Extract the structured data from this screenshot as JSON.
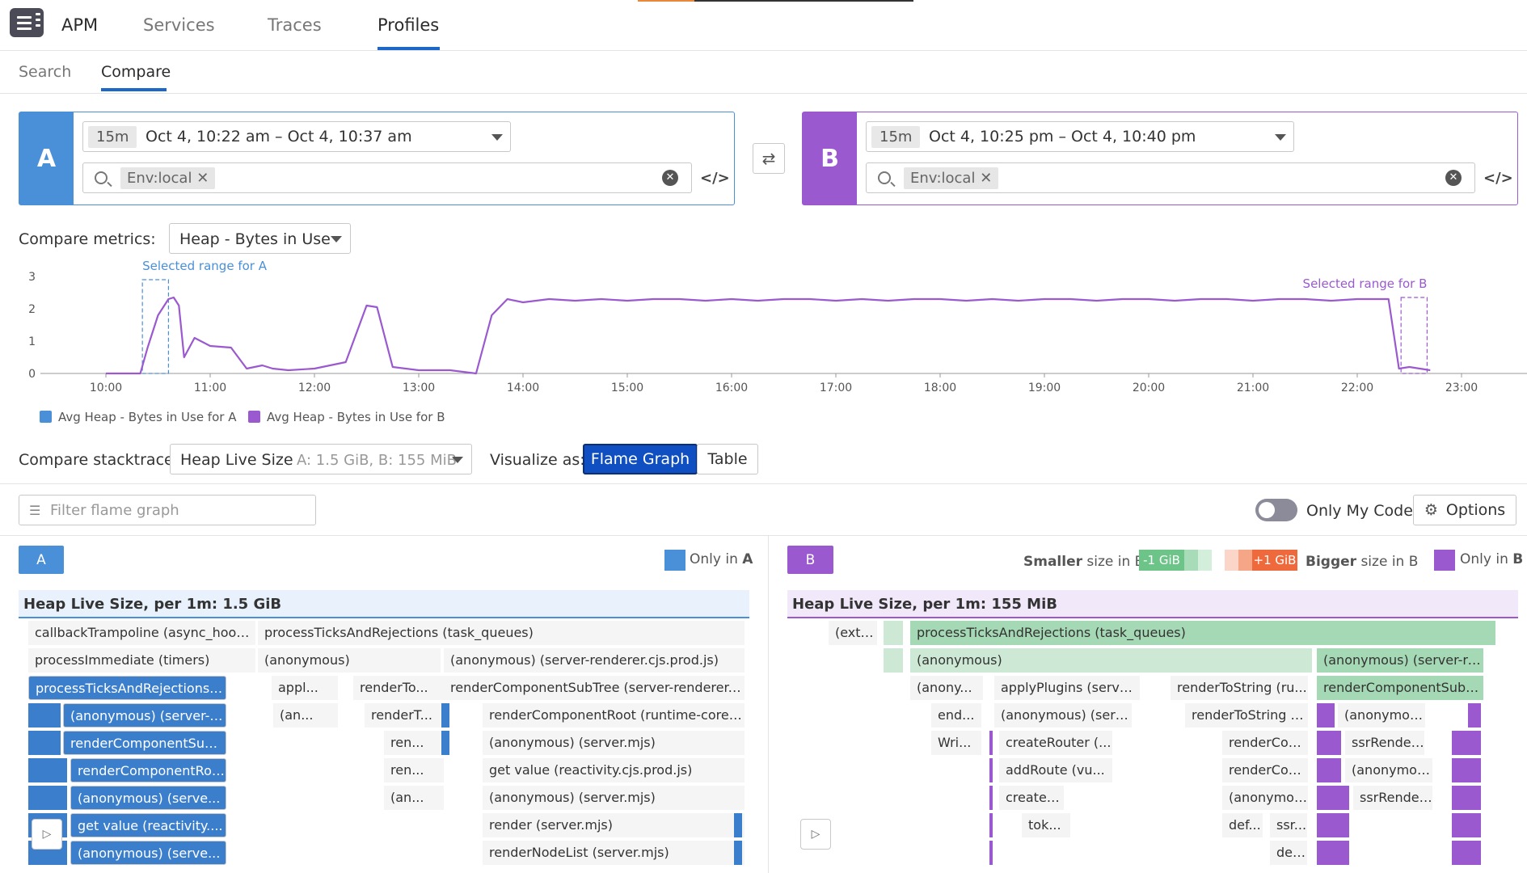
{
  "nav": {
    "brand": "APM",
    "tabs": [
      "Services",
      "Traces",
      "Profiles"
    ]
  },
  "subnav": {
    "tabs": [
      "Search",
      "Compare"
    ]
  },
  "panel_a": {
    "label": "A",
    "duration": "15m",
    "range": "Oct 4, 10:22 am – Oct 4, 10:37 am",
    "filter": "Env:local",
    "color": "#4a90d9"
  },
  "panel_b": {
    "label": "B",
    "duration": "15m",
    "range": "Oct 4, 10:25 pm – Oct 4, 10:40 pm",
    "filter": "Env:local",
    "color": "#9b59d0"
  },
  "compare_metrics": {
    "label": "Compare metrics:",
    "value": "Heap - Bytes in Use"
  },
  "chart_data": {
    "type": "line",
    "y_ticks": [
      "3",
      "2",
      "1",
      "0"
    ],
    "x_ticks": [
      "10:00",
      "11:00",
      "12:00",
      "13:00",
      "14:00",
      "15:00",
      "16:00",
      "17:00",
      "18:00",
      "19:00",
      "20:00",
      "21:00",
      "22:00",
      "23:00"
    ],
    "ylim": [
      0,
      3
    ],
    "annotations": [
      "Selected range for A",
      "Selected range for B"
    ],
    "series": [
      {
        "name": "Avg Heap - Bytes in Use for B",
        "color": "#9b59d0",
        "x": [
          10.0,
          10.33,
          10.4,
          10.5,
          10.6,
          10.65,
          10.7,
          10.75,
          10.85,
          11.0,
          11.2,
          11.35,
          11.5,
          11.6,
          11.75,
          12.0,
          12.3,
          12.5,
          12.6,
          12.75,
          13.0,
          13.3,
          13.55,
          13.7,
          13.85,
          14.0,
          14.25,
          14.5,
          14.75,
          15.0,
          15.25,
          15.5,
          15.75,
          16.0,
          16.25,
          16.5,
          16.75,
          17.0,
          17.25,
          17.5,
          17.75,
          18.0,
          18.25,
          18.5,
          18.75,
          19.0,
          19.25,
          19.5,
          19.75,
          20.0,
          20.25,
          20.5,
          20.75,
          21.0,
          21.25,
          21.5,
          21.75,
          22.0,
          22.3,
          22.4,
          22.5,
          22.7
        ],
        "y": [
          0.0,
          0.0,
          0.8,
          1.8,
          2.3,
          2.35,
          2.1,
          0.5,
          1.1,
          0.85,
          0.8,
          0.15,
          0.25,
          0.15,
          0.1,
          0.15,
          0.35,
          2.1,
          2.05,
          0.2,
          0.1,
          0.1,
          0.0,
          1.8,
          2.3,
          2.2,
          2.3,
          2.25,
          2.3,
          2.25,
          2.3,
          2.3,
          2.25,
          2.3,
          2.25,
          2.3,
          2.3,
          2.25,
          2.3,
          2.25,
          2.3,
          2.3,
          2.25,
          2.3,
          2.25,
          2.3,
          2.3,
          2.25,
          2.3,
          2.3,
          2.25,
          2.3,
          2.3,
          2.25,
          2.3,
          2.3,
          2.25,
          2.3,
          2.3,
          0.15,
          0.2,
          0.1
        ]
      }
    ],
    "legend": [
      "Avg Heap - Bytes in Use for A",
      "Avg Heap - Bytes in Use for B"
    ],
    "legend_colors": [
      "#4a90d9",
      "#9b59d0"
    ]
  },
  "stack": {
    "label": "Compare stacktrace:",
    "value": "Heap Live Size",
    "detail": "A: 1.5 GiB, B: 155 MiB",
    "vis_label": "Visualize as:",
    "options": [
      "Flame Graph",
      "Table"
    ]
  },
  "filter": {
    "placeholder": "Filter flame graph",
    "toggle_label": "Only My Code",
    "options_label": "Options"
  },
  "flame_a": {
    "badge": "A",
    "only_label": "Only in",
    "only_letter": "A",
    "header": "Heap Live Size, per 1m: 1.5 GiB",
    "rows": [
      [
        "callbackTrampoline (async_hooks)",
        "processTicksAndRejections (task_queues)"
      ],
      [
        "processImmediate (timers)",
        "(anonymous)",
        "(anonymous) (server-renderer.cjs.prod.js)"
      ],
      [
        "processTicksAndRejections (...",
        "appl...",
        "renderTo...",
        "renderComponentSubTree (server-renderer.cjs.p..."
      ],
      [
        "(anonymous) (server-re...",
        "(an...",
        "renderT...",
        "renderComponentRoot (runtime-core.c..."
      ],
      [
        "renderComponentSubTre...",
        "ren...",
        "(anonymous) (server.mjs)"
      ],
      [
        "renderComponentRoot...",
        "ren...",
        "get value (reactivity.cjs.prod.js)"
      ],
      [
        "(anonymous) (serve...",
        "(an...",
        "(anonymous) (server.mjs)"
      ],
      [
        "get value (reactivity....",
        "render (server.mjs)"
      ],
      [
        "(anonymous) (serve...",
        "renderNodeList (server.mjs)"
      ]
    ]
  },
  "flame_b": {
    "badge": "B",
    "smaller_bold": "Smaller",
    "smaller_rest": "size in B",
    "scale_min": "-1 GiB",
    "scale_max": "+1 GiB",
    "bigger_bold": "Bigger",
    "bigger_rest": "size in B",
    "only_label": "Only in",
    "only_letter": "B",
    "header": "Heap Live Size, per 1m: 155 MiB",
    "rows": [
      [
        "(exte...",
        "processTicksAndRejections (task_queues)"
      ],
      [
        "(anonymous)",
        "(anonymous) (server-ren..."
      ],
      [
        "(anony...",
        "applyPlugins (server....",
        "renderToString (ru...",
        "renderComponentSubTree..."
      ],
      [
        "end...",
        "(anonymous) (serve...",
        "renderToString (s...",
        "(anonymous) ..."
      ],
      [
        "Wri...",
        "createRouter (...",
        "renderComp...",
        "ssrRenderLi..."
      ],
      [
        "addRoute (vu...",
        "renderComp...",
        "(anonymous..."
      ],
      [
        "createR...",
        "(anonymous...",
        "ssrRender..."
      ],
      [
        "tok...",
        "def...",
        "ssr..."
      ],
      [
        "def..."
      ]
    ]
  }
}
